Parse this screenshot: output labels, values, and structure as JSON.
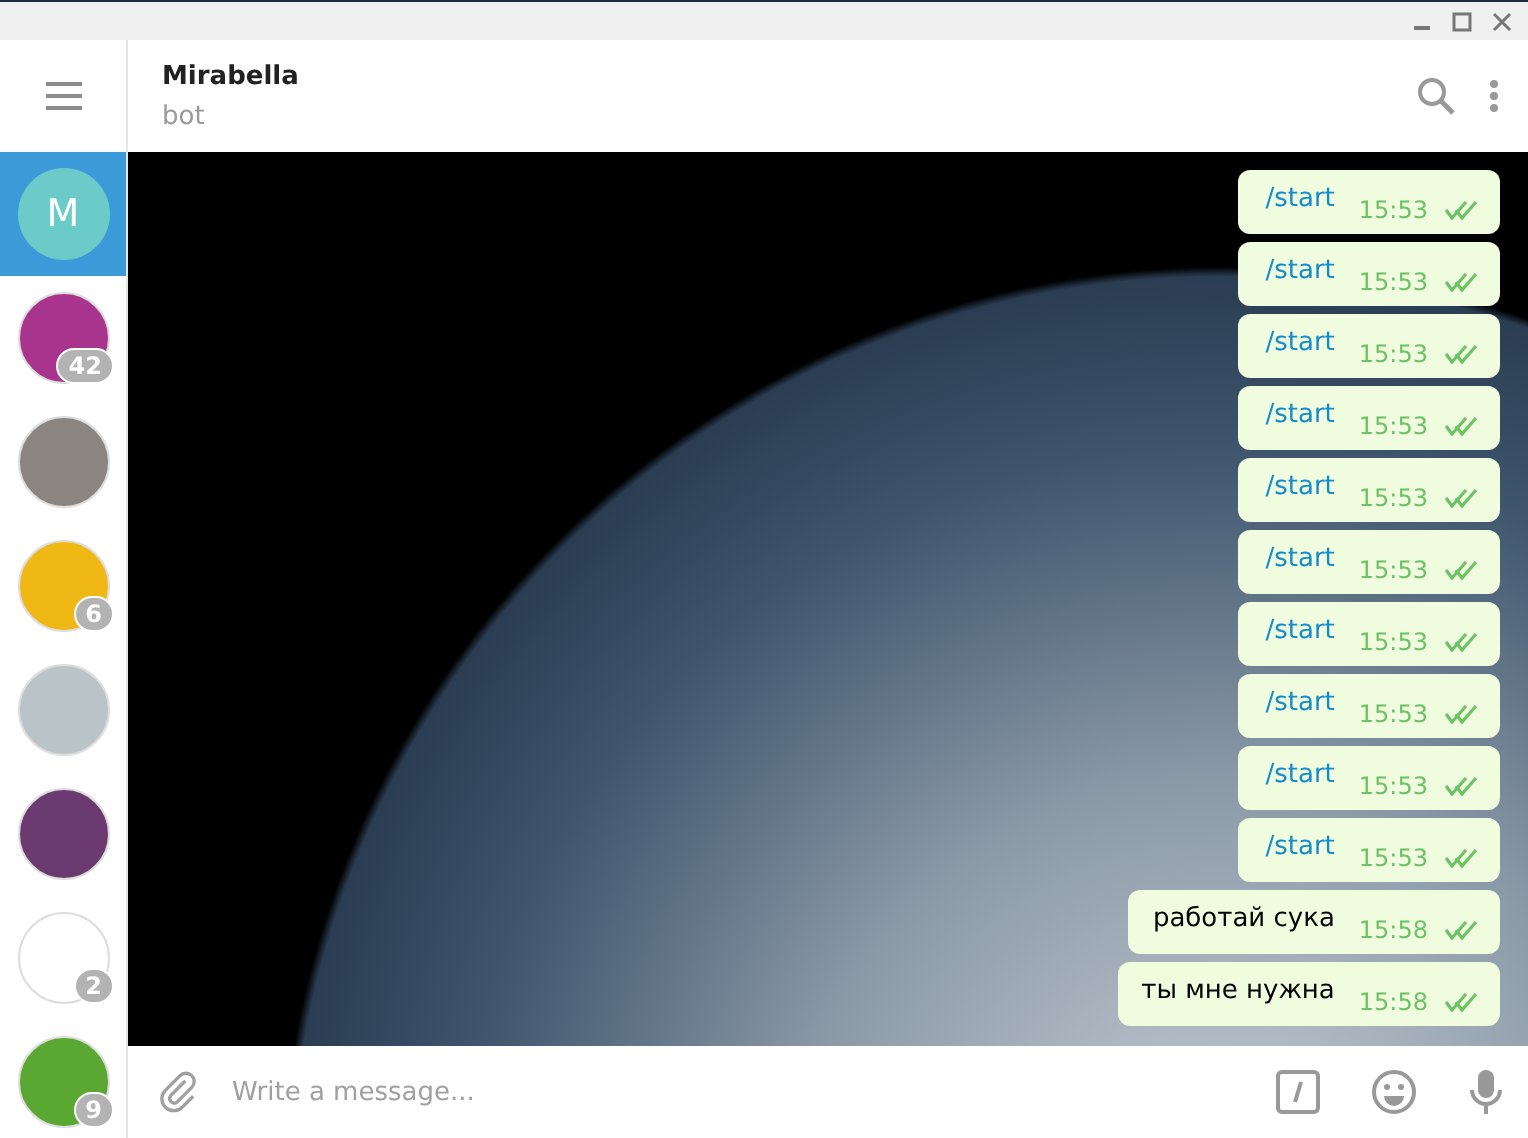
{
  "chat": {
    "title": "Mirabella",
    "subtitle": "bot"
  },
  "dialogs": [
    {
      "kind": "letter",
      "initial": "M",
      "color": "#6bcbc9",
      "selected": true
    },
    {
      "kind": "logo",
      "color": "#a8348e",
      "badge": "42",
      "selected": false
    },
    {
      "kind": "photo",
      "color": "#8a8580",
      "selected": false
    },
    {
      "kind": "logo",
      "color": "#f0b814",
      "badge": "6",
      "selected": false
    },
    {
      "kind": "photo",
      "color": "#b9c3c8",
      "selected": false
    },
    {
      "kind": "photo",
      "color": "#6a3a70",
      "selected": false
    },
    {
      "kind": "logo",
      "color": "#ffffff",
      "badge": "2",
      "selected": false
    },
    {
      "kind": "logo",
      "color": "#5aa832",
      "badge": "9",
      "selected": false
    }
  ],
  "messages": [
    {
      "kind": "command",
      "text": "/start",
      "time": "15:53",
      "read": true
    },
    {
      "kind": "command",
      "text": "/start",
      "time": "15:53",
      "read": true
    },
    {
      "kind": "command",
      "text": "/start",
      "time": "15:53",
      "read": true
    },
    {
      "kind": "command",
      "text": "/start",
      "time": "15:53",
      "read": true
    },
    {
      "kind": "command",
      "text": "/start",
      "time": "15:53",
      "read": true
    },
    {
      "kind": "command",
      "text": "/start",
      "time": "15:53",
      "read": true
    },
    {
      "kind": "command",
      "text": "/start",
      "time": "15:53",
      "read": true
    },
    {
      "kind": "command",
      "text": "/start",
      "time": "15:53",
      "read": true
    },
    {
      "kind": "command",
      "text": "/start",
      "time": "15:53",
      "read": true
    },
    {
      "kind": "command",
      "text": "/start",
      "time": "15:53",
      "read": true
    },
    {
      "kind": "text",
      "text": "работай сука",
      "time": "15:58",
      "read": true
    },
    {
      "kind": "text",
      "text": "ты мне нужна",
      "time": "15:58",
      "read": true
    }
  ],
  "composer": {
    "placeholder": "Write a message..."
  }
}
